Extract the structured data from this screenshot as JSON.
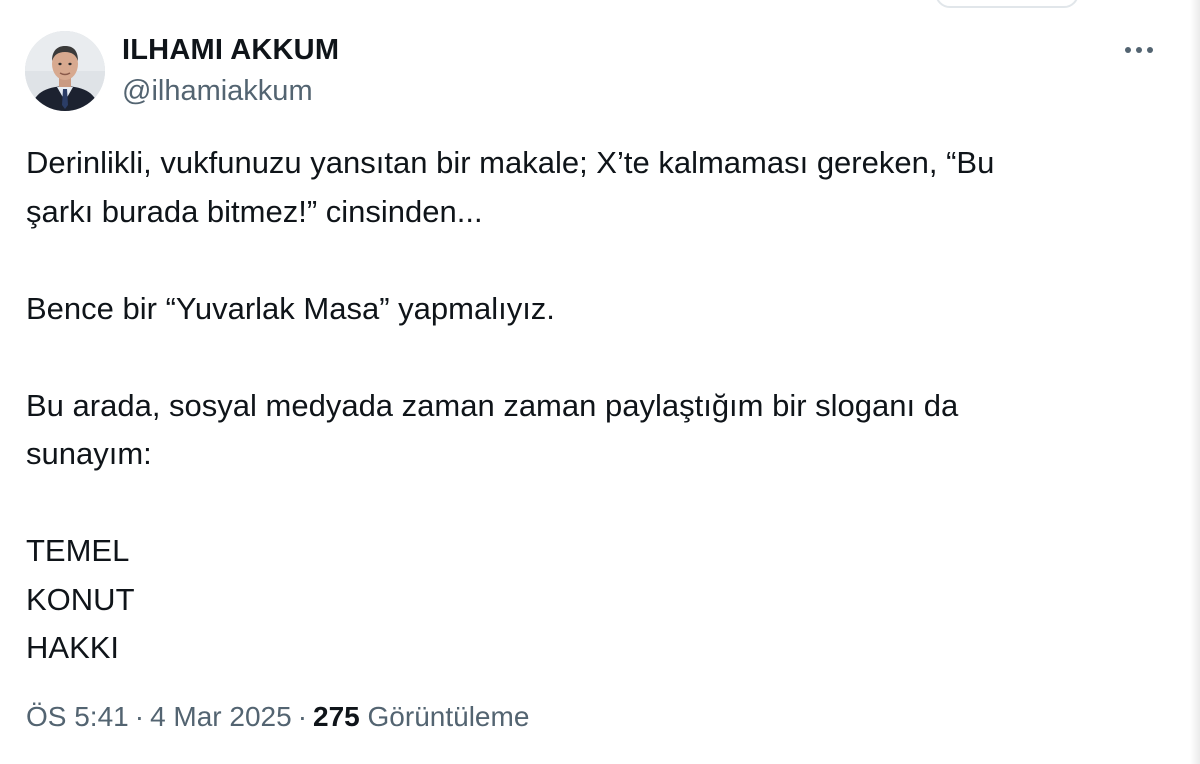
{
  "author": {
    "name": "ILHAMI AKKUM",
    "handle": "@ilhamiakkum",
    "avatar_icon": "user-avatar-photo"
  },
  "menu_icon": "more-horizontal-icon",
  "tweet": {
    "text": "Derinlikli, vukfunuzu yansıtan bir makale; X’te kalmaması gereken, “Bu\nşarkı burada bitmez!” cinsinden...\n\nBence bir “Yuvarlak Masa” yapmalıyız.\n\nBu arada, sosyal medyada zaman zaman paylaştığım bir sloganı da\nsunayım:\n\nTEMEL\nKONUT\nHAKKI"
  },
  "meta": {
    "time": "ÖS 5:41",
    "separator": "·",
    "date": "4 Mar 2025",
    "views_count": "275",
    "views_label": "Görüntüleme"
  },
  "colors": {
    "text_primary": "#0f1419",
    "text_secondary": "#536471",
    "background": "#ffffff"
  }
}
